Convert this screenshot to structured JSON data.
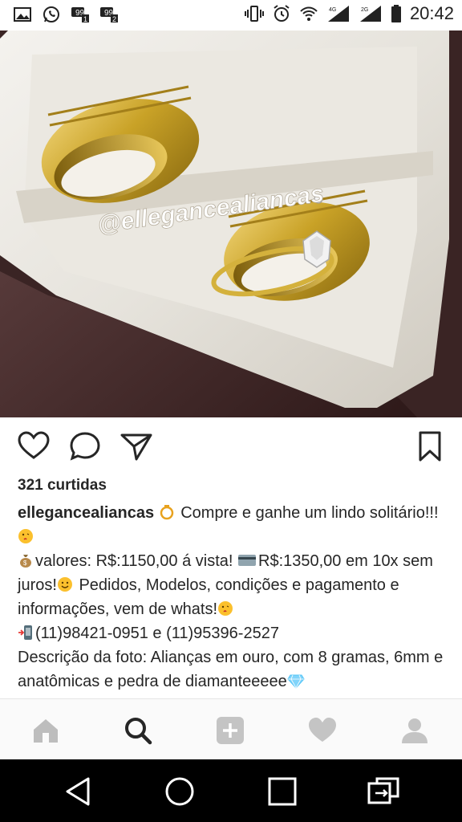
{
  "status_bar": {
    "time": "20:42",
    "left_icons": [
      "gallery-icon",
      "whatsapp-icon",
      "chat-1-icon",
      "chat-2-icon"
    ],
    "right_icons": [
      "vibrate-icon",
      "alarm-icon",
      "wifi-icon",
      "signal-4g-icon",
      "signal-2g-icon",
      "battery-icon"
    ]
  },
  "post": {
    "watermark": "@ellegancealiancas",
    "likes": "321 curtidas",
    "username": "ellegancealiancas",
    "caption": {
      "line1": " Compre e ganhe um lindo solitário!!!",
      "line2_a": "valores: R$:1150,00 á vista! ",
      "line2_b": "R$:1350,00 em 10x sem juros!",
      "line2_c": " Pedidos, Modelos, condições e pagamento e informações, vem de whats!",
      "line3": "(11)98421-0951 e (11)95396-2527",
      "line4": "Descrição da foto: Alianças em ouro, com 8 gramas, 6mm e anatômicas e pedra de diamanteeeee"
    },
    "actions": [
      "heart-icon",
      "comment-icon",
      "share-icon",
      "bookmark-icon"
    ]
  },
  "bottom_nav": [
    "home-icon",
    "search-icon",
    "add-icon",
    "activity-icon",
    "profile-icon"
  ],
  "system_nav": [
    "back-icon",
    "home-circle-icon",
    "recents-icon",
    "switch-icon"
  ],
  "colors": {
    "gold": "#c9a227",
    "text": "#262626",
    "nav_bg": "#fafafa"
  }
}
